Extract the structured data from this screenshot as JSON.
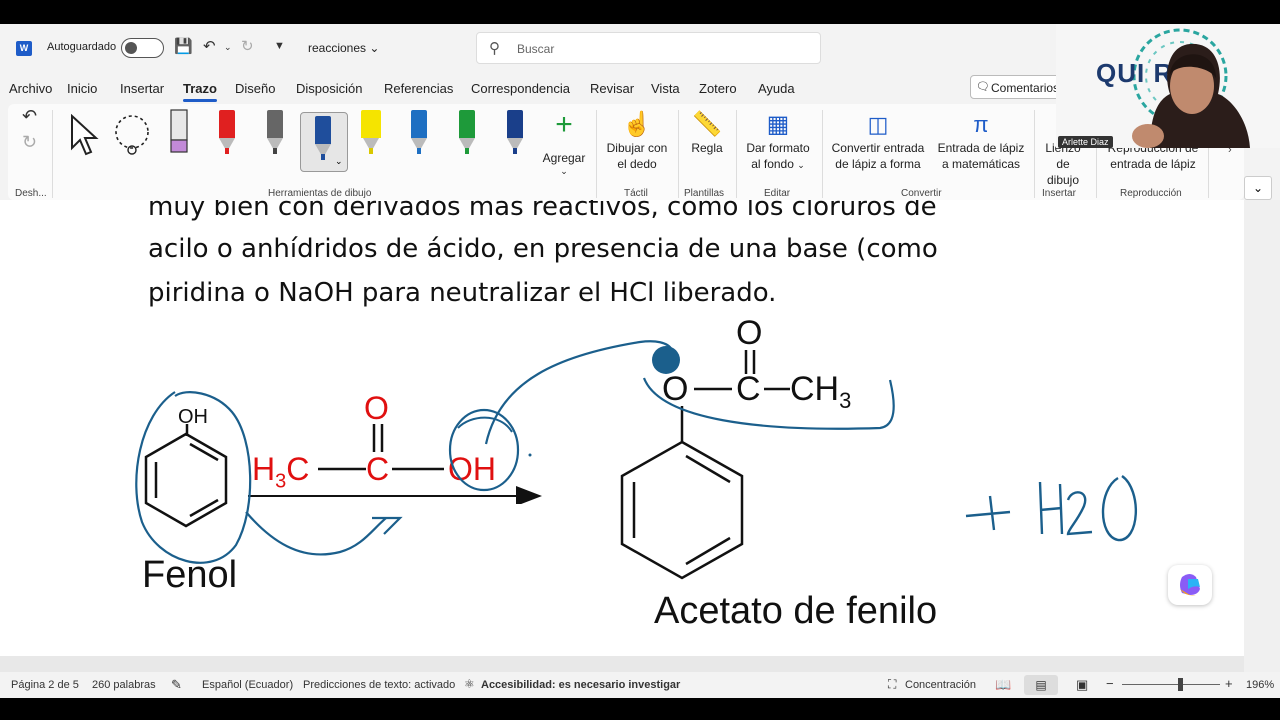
{
  "titlebar": {
    "app_icon": "word-icon",
    "autosave_label": "Autoguardado",
    "autosave_on": false,
    "doc_name": "reacciones",
    "search_placeholder": "Buscar"
  },
  "menu": {
    "items": [
      "Archivo",
      "Inicio",
      "Insertar",
      "Trazo",
      "Diseño",
      "Disposición",
      "Referencias",
      "Correspondencia",
      "Revisar",
      "Vista",
      "Zotero",
      "Ayuda"
    ],
    "active": "Trazo",
    "comments_label": "Comentarios"
  },
  "ribbon": {
    "undo_group_label": "Desh...",
    "drawing_tools_label": "Herramientas de dibujo",
    "add_label": "Agregar",
    "draw_touch_label_1": "Dibujar con",
    "draw_touch_label_2": "el dedo",
    "touch_group_label": "Táctil",
    "ruler_label": "Regla",
    "templates_group_label": "Plantillas",
    "bg_label_1": "Dar formato",
    "bg_label_2": "al fondo",
    "edit_group_label": "Editar",
    "convert_shape_1": "Convertir entrada",
    "convert_shape_2": "de lápiz a forma",
    "convert_math_1": "Entrada de lápiz",
    "convert_math_2": "a matemáticas",
    "convert_group_label": "Convertir",
    "canvas_1": "Lienzo de",
    "canvas_2": "dibujo",
    "insert_group_label": "Insertar",
    "replay_1": "Reproducción de",
    "replay_2": "entrada de lápiz",
    "replay_group_label": "Reproducción",
    "pen_colors": [
      "#e02020",
      "#555555",
      "#1f4e9c",
      "#f5e400",
      "#1e6fc2",
      "#1e9a3a",
      "#1a3f8a"
    ]
  },
  "document": {
    "lines": [
      "muy bien con derivados más reactivos, como los cloruros de",
      "acilo o anhídridos de ácido, en presencia de una base (como",
      "piridina o NaOH para neutralizar el HCl liberado."
    ],
    "phenol_oh": "OH",
    "phenol_name": "Fenol",
    "acid_h3c": "H3C",
    "acid_c": "C",
    "acid_o": "O",
    "acid_oh": "OH",
    "ester_o_top": "O",
    "ester_o": "O",
    "ester_c": "C",
    "ester_ch3": "CH3",
    "product_name": "Acetato de fenilo",
    "handwritten": "+ H2O",
    "red_color": "#e01010",
    "ink_color": "#1b5f8c"
  },
  "webcam": {
    "logo_text": "QUI    R",
    "name_tag": "Arlette Diaz"
  },
  "status": {
    "page": "Página 2 de 5",
    "words": "260 palabras",
    "language": "Español (Ecuador)",
    "predictions": "Predicciones de texto: activado",
    "accessibility": "Accesibilidad: es necesario investigar",
    "focus": "Concentración",
    "zoom": "196%"
  }
}
